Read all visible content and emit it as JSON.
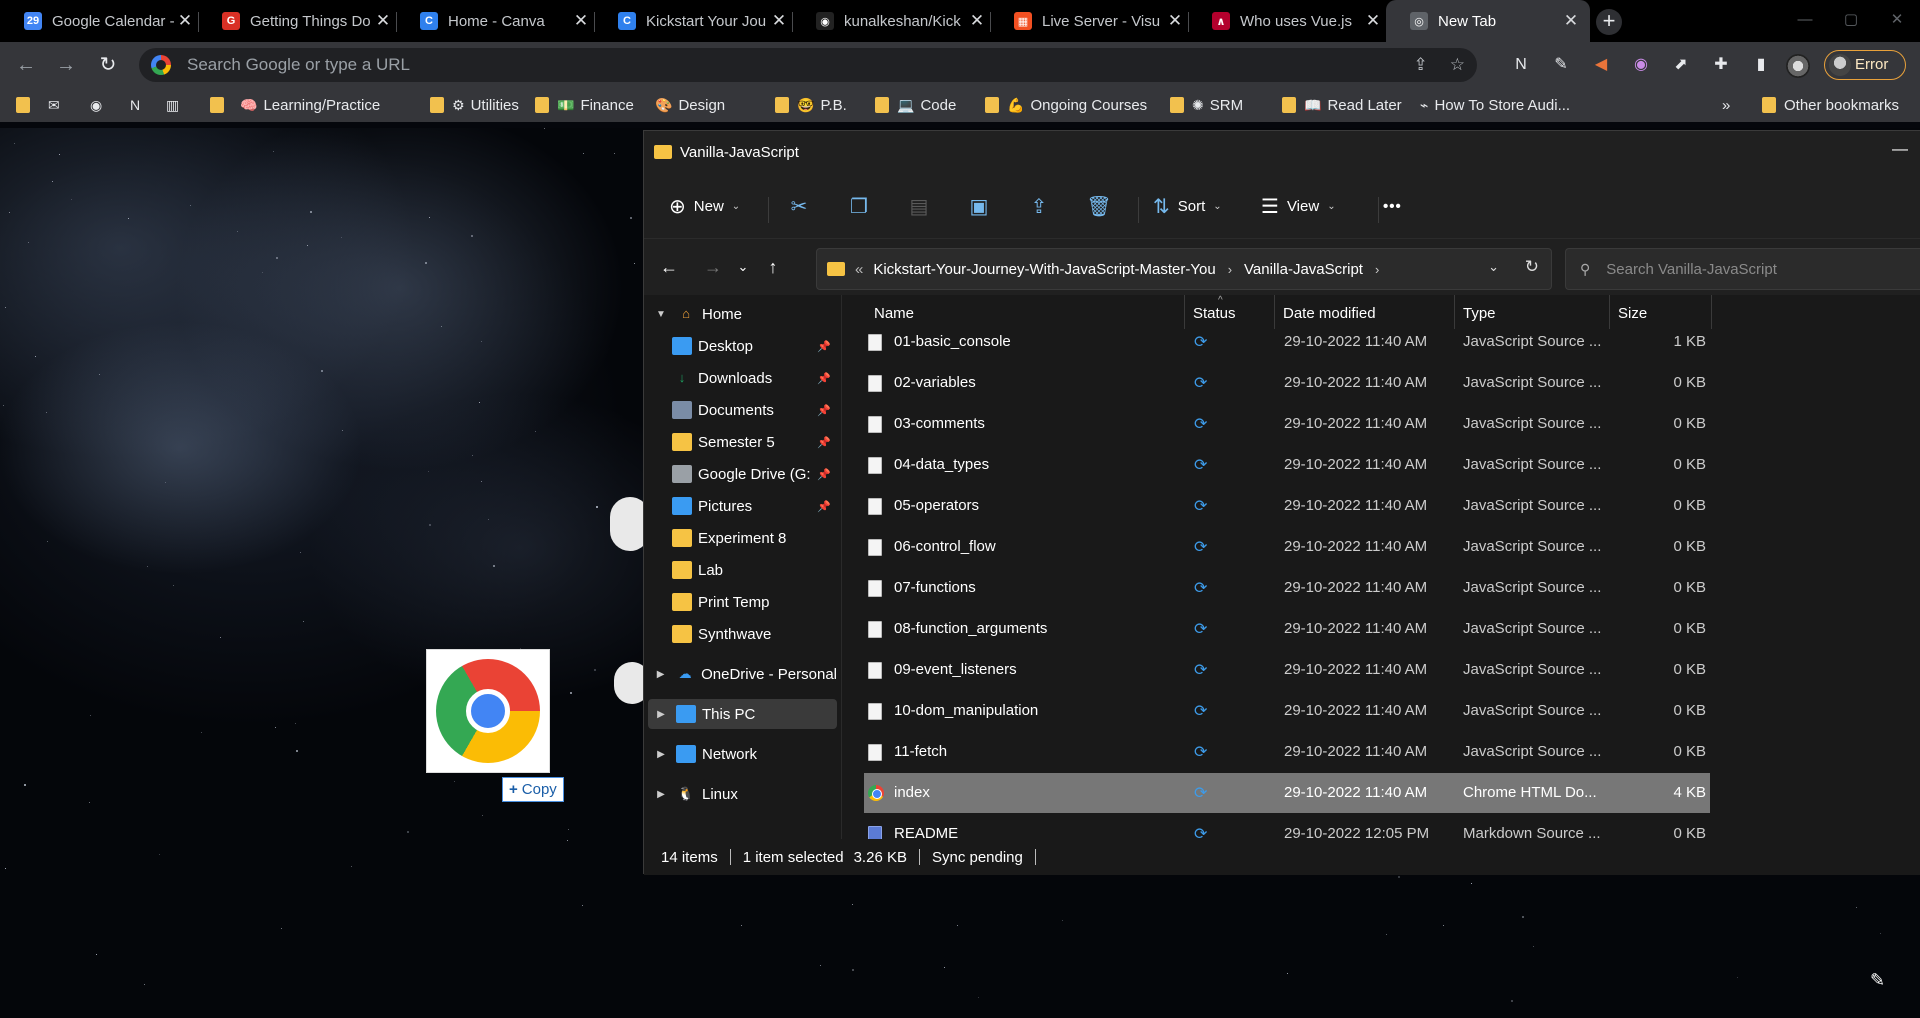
{
  "browser": {
    "tabs": [
      {
        "title": "Google Calendar -",
        "favicon_color": "#4285f4",
        "favicon_text": "29"
      },
      {
        "title": "Getting Things Do",
        "favicon_color": "#d93025",
        "favicon_text": "G"
      },
      {
        "title": "Home - Canva",
        "favicon_color": "#2f80ed",
        "favicon_text": "C"
      },
      {
        "title": "Kickstart Your Jou",
        "favicon_color": "#2f80ed",
        "favicon_text": "C"
      },
      {
        "title": "kunalkeshan/Kick",
        "favicon_color": "#222222",
        "favicon_text": "◉"
      },
      {
        "title": "Live Server - Visu",
        "favicon_color": "#f25022",
        "favicon_text": "▦"
      },
      {
        "title": "Who uses Vue.js",
        "favicon_color": "#b3002d",
        "favicon_text": "∧"
      },
      {
        "title": "New Tab",
        "favicon_color": "#5f6368",
        "favicon_text": "◎",
        "active": true
      }
    ],
    "close_glyph": "✕",
    "new_tab_glyph": "+",
    "window_controls": [
      "—",
      "▢",
      "✕"
    ],
    "omnibox": {
      "placeholder": "Search Google or type a URL"
    },
    "error_button": "Error",
    "bookmarks": [
      {
        "label": "",
        "icon": "folder"
      },
      {
        "label": "",
        "icon": "mail-icon",
        "glyph": "✉"
      },
      {
        "label": "",
        "icon": "github-icon",
        "glyph": "◉"
      },
      {
        "label": "",
        "icon": "notion-icon",
        "glyph": "N"
      },
      {
        "label": "",
        "icon": "trello-icon",
        "glyph": "▥"
      },
      {
        "label": "",
        "icon": "folder"
      },
      {
        "label": "Learning/Practice",
        "icon": "brain-icon",
        "glyph": "🧠"
      },
      {
        "label": "Utilities",
        "icon": "gear-icon",
        "glyph": "⚙",
        "folder": true
      },
      {
        "label": "Finance",
        "icon": "money-icon",
        "glyph": "💵",
        "folder": true
      },
      {
        "label": "Design",
        "icon": "palette-icon",
        "glyph": "🎨"
      },
      {
        "label": "P.B.",
        "icon": "face-icon",
        "glyph": "🤓",
        "folder": true
      },
      {
        "label": "Code",
        "icon": "laptop-icon",
        "glyph": "💻",
        "folder": true
      },
      {
        "label": "Ongoing Courses",
        "icon": "muscle-icon",
        "glyph": "💪",
        "folder": true
      },
      {
        "label": "SRM",
        "icon": "srm-icon",
        "glyph": "✺",
        "folder": true
      },
      {
        "label": "Read Later",
        "icon": "book-icon",
        "glyph": "📖",
        "folder": true
      },
      {
        "label": "How To Store Audi...",
        "icon": "site-icon",
        "glyph": "⌁"
      },
      {
        "label": "»",
        "icon": "chevron-icon"
      },
      {
        "label": "Other bookmarks",
        "icon": "folder"
      }
    ]
  },
  "explorer": {
    "title": "Vanilla-JavaScript",
    "commands": {
      "new": "New",
      "sort": "Sort",
      "view": "View",
      "more": "•••"
    },
    "address": {
      "prefix": "«",
      "crumbs": [
        "Kickstart-Your-Journey-With-JavaScript-Master-You",
        "Vanilla-JavaScript"
      ]
    },
    "search_placeholder": "Search Vanilla-JavaScript",
    "nav": [
      {
        "label": "Home",
        "expandable": true,
        "expanded": true,
        "icon_color": "#f3a43a",
        "glyph": "⌂",
        "indent": 0
      },
      {
        "label": "Desktop",
        "pinned": true,
        "icon_color": "#3a9bf2",
        "indent": 1
      },
      {
        "label": "Downloads",
        "pinned": true,
        "icon_color": "#1ea362",
        "glyph": "↓",
        "indent": 1
      },
      {
        "label": "Documents",
        "pinned": true,
        "icon_color": "#7a8ca6",
        "indent": 1
      },
      {
        "label": "Semester 5",
        "pinned": true,
        "icon_color": "#f6c344",
        "indent": 1
      },
      {
        "label": "Google Drive (G:",
        "pinned": true,
        "icon_color": "#9aa0a6",
        "indent": 1
      },
      {
        "label": "Pictures",
        "pinned": true,
        "icon_color": "#3a9bf2",
        "indent": 1
      },
      {
        "label": "Experiment 8",
        "icon_color": "#f6c344",
        "indent": 1
      },
      {
        "label": "Lab",
        "icon_color": "#f6c344",
        "indent": 1
      },
      {
        "label": "Print Temp",
        "icon_color": "#f6c344",
        "indent": 1
      },
      {
        "label": "Synthwave",
        "icon_color": "#f6c344",
        "indent": 1
      },
      {
        "label": "OneDrive - Personal",
        "expandable": true,
        "icon_color": "#3a9bf2",
        "glyph": "☁",
        "indent": 0
      },
      {
        "label": "This PC",
        "expandable": true,
        "selected": true,
        "icon_color": "#3a9bf2",
        "indent": 0
      },
      {
        "label": "Network",
        "expandable": true,
        "icon_color": "#3a9bf2",
        "indent": 0
      },
      {
        "label": "Linux",
        "expandable": true,
        "icon_color": "#ddd",
        "glyph": "🐧",
        "indent": 0
      }
    ],
    "columns": [
      "Name",
      "Status",
      "Date modified",
      "Type",
      "Size"
    ],
    "files": [
      {
        "name": "01-basic_console",
        "date": "29-10-2022 11:40 AM",
        "type": "JavaScript Source ...",
        "size": "1 KB"
      },
      {
        "name": "02-variables",
        "date": "29-10-2022 11:40 AM",
        "type": "JavaScript Source ...",
        "size": "0 KB"
      },
      {
        "name": "03-comments",
        "date": "29-10-2022 11:40 AM",
        "type": "JavaScript Source ...",
        "size": "0 KB"
      },
      {
        "name": "04-data_types",
        "date": "29-10-2022 11:40 AM",
        "type": "JavaScript Source ...",
        "size": "0 KB"
      },
      {
        "name": "05-operators",
        "date": "29-10-2022 11:40 AM",
        "type": "JavaScript Source ...",
        "size": "0 KB"
      },
      {
        "name": "06-control_flow",
        "date": "29-10-2022 11:40 AM",
        "type": "JavaScript Source ...",
        "size": "0 KB"
      },
      {
        "name": "07-functions",
        "date": "29-10-2022 11:40 AM",
        "type": "JavaScript Source ...",
        "size": "0 KB"
      },
      {
        "name": "08-function_arguments",
        "date": "29-10-2022 11:40 AM",
        "type": "JavaScript Source ...",
        "size": "0 KB"
      },
      {
        "name": "09-event_listeners",
        "date": "29-10-2022 11:40 AM",
        "type": "JavaScript Source ...",
        "size": "0 KB"
      },
      {
        "name": "10-dom_manipulation",
        "date": "29-10-2022 11:40 AM",
        "type": "JavaScript Source ...",
        "size": "0 KB"
      },
      {
        "name": "11-fetch",
        "date": "29-10-2022 11:40 AM",
        "type": "JavaScript Source ...",
        "size": "0 KB"
      },
      {
        "name": "index",
        "date": "29-10-2022 11:40 AM",
        "type": "Chrome HTML Do...",
        "size": "4 KB",
        "selected": true,
        "kind": "chrome"
      },
      {
        "name": "README",
        "date": "29-10-2022 12:05 PM",
        "type": "Markdown Source ...",
        "size": "0 KB",
        "kind": "md"
      }
    ],
    "status_icon": "⟳",
    "statusbar": {
      "items": "14 items",
      "selection": "1 item selected",
      "size": "3.26 KB",
      "sync": "Sync pending"
    }
  },
  "drag": {
    "tooltip_plus": "+",
    "tooltip_label": "Copy"
  }
}
